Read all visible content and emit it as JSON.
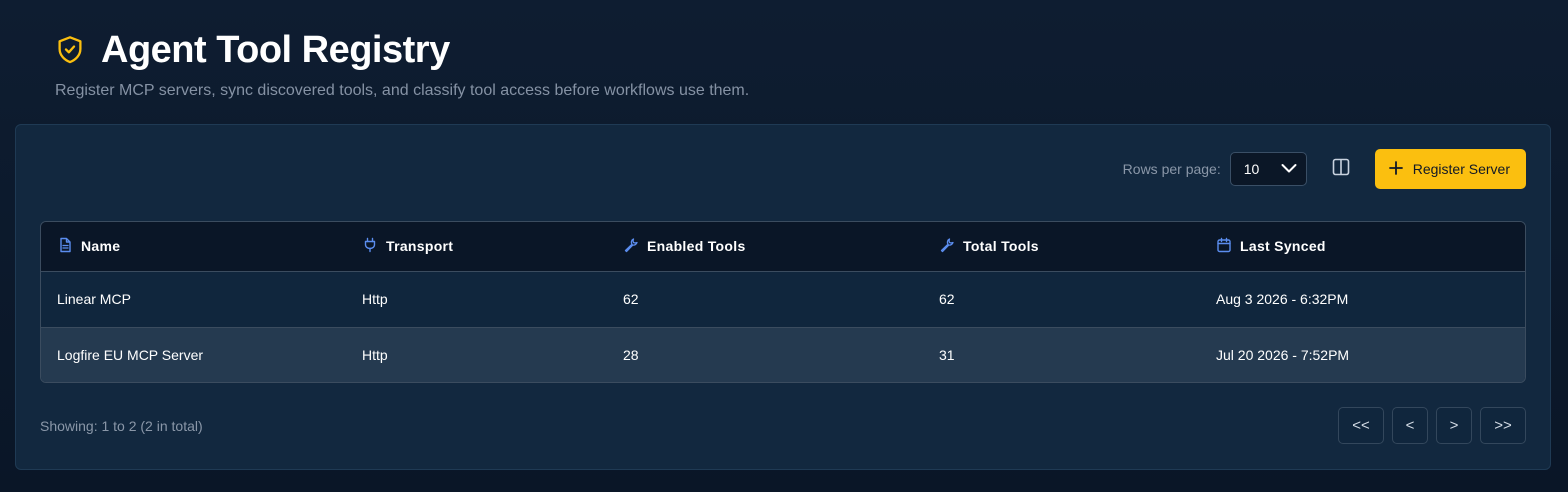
{
  "header": {
    "title": "Agent Tool Registry",
    "subtitle": "Register MCP servers, sync discovered tools, and classify tool access before workflows use them."
  },
  "toolbar": {
    "rows_label": "Rows per page:",
    "rows_value": "10",
    "register_label": "Register Server"
  },
  "table": {
    "headers": {
      "name": "Name",
      "transport": "Transport",
      "enabled": "Enabled Tools",
      "total": "Total Tools",
      "synced": "Last Synced"
    },
    "rows": [
      {
        "name": "Linear MCP",
        "transport": "Http",
        "enabled": "62",
        "total": "62",
        "synced": "Aug 3 2026 - 6:32PM"
      },
      {
        "name": "Logfire EU MCP Server",
        "transport": "Http",
        "enabled": "28",
        "total": "31",
        "synced": "Jul 20 2026 - 7:52PM"
      }
    ]
  },
  "footer": {
    "showing": "Showing: 1 to 2 (2 in total)",
    "first": "<<",
    "prev": "<",
    "next": ">",
    "last": ">>"
  },
  "colors": {
    "accent": "#fbbf0f",
    "icon_blue": "#5b8def",
    "background": "#0c1a2d"
  }
}
